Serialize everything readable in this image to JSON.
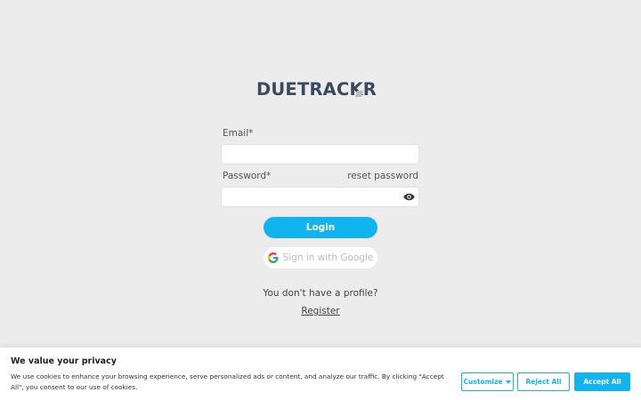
{
  "brand": {
    "logo_text": "DUETRAC",
    "logo_text_end": "K",
    "logo_text_last": "R",
    "primary_color": "#11b4ef",
    "logo_color": "#3a4a5c"
  },
  "login_form": {
    "email_label": "Email*",
    "email_value": "",
    "password_label": "Password*",
    "password_value": "",
    "reset_password_label": "reset password",
    "show_password_icon": "eye-icon",
    "login_label": "Login",
    "google_label": "Sign in with Google",
    "google_icon": "google-icon",
    "no_profile_text": "You don't have a profile?",
    "register_label": "Register"
  },
  "cookie_banner": {
    "title": "We value your privacy",
    "text": "We use cookies to enhance your browsing experience, serve personalized ads or content, and analyze our traffic. By clicking \"Accept All\", you consent to our use of cookies.",
    "customize_label": "Customize",
    "reject_label": "Reject All",
    "accept_label": "Accept All"
  }
}
